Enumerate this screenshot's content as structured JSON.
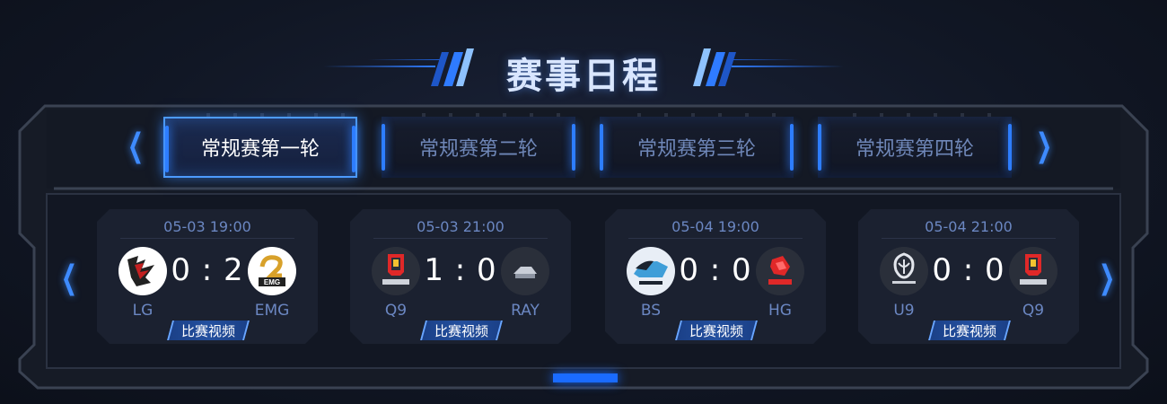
{
  "page": {
    "title": "赛事日程",
    "accent_color": "#2d7dff"
  },
  "rounds": {
    "prev_icon": "chevron-left-icon",
    "next_icon": "chevron-right-icon",
    "tabs": [
      {
        "label": "常规赛第一轮",
        "active": true
      },
      {
        "label": "常规赛第二轮",
        "active": false
      },
      {
        "label": "常规赛第三轮",
        "active": false
      },
      {
        "label": "常规赛第四轮",
        "active": false
      }
    ]
  },
  "matches": {
    "prev_icon": "chevron-left-icon",
    "next_icon": "chevron-right-icon",
    "items": [
      {
        "time": "05-03 19:00",
        "home": "LG",
        "away": "EMG",
        "score": "0 : 2",
        "video_label": "比赛视频",
        "home_logo": "lg-logo",
        "away_logo": "emg-logo"
      },
      {
        "time": "05-03 21:00",
        "home": "Q9",
        "away": "RAY",
        "score": "1 : 0",
        "video_label": "比赛视频",
        "home_logo": "q9-logo",
        "away_logo": "ray-logo"
      },
      {
        "time": "05-04 19:00",
        "home": "BS",
        "away": "HG",
        "score": "0 : 0",
        "video_label": "比赛视频",
        "home_logo": "bs-logo",
        "away_logo": "hg-logo"
      },
      {
        "time": "05-04 21:00",
        "home": "U9",
        "away": "Q9",
        "score": "0 : 0",
        "video_label": "比赛视频",
        "home_logo": "u9-logo",
        "away_logo": "q9-logo"
      }
    ]
  }
}
